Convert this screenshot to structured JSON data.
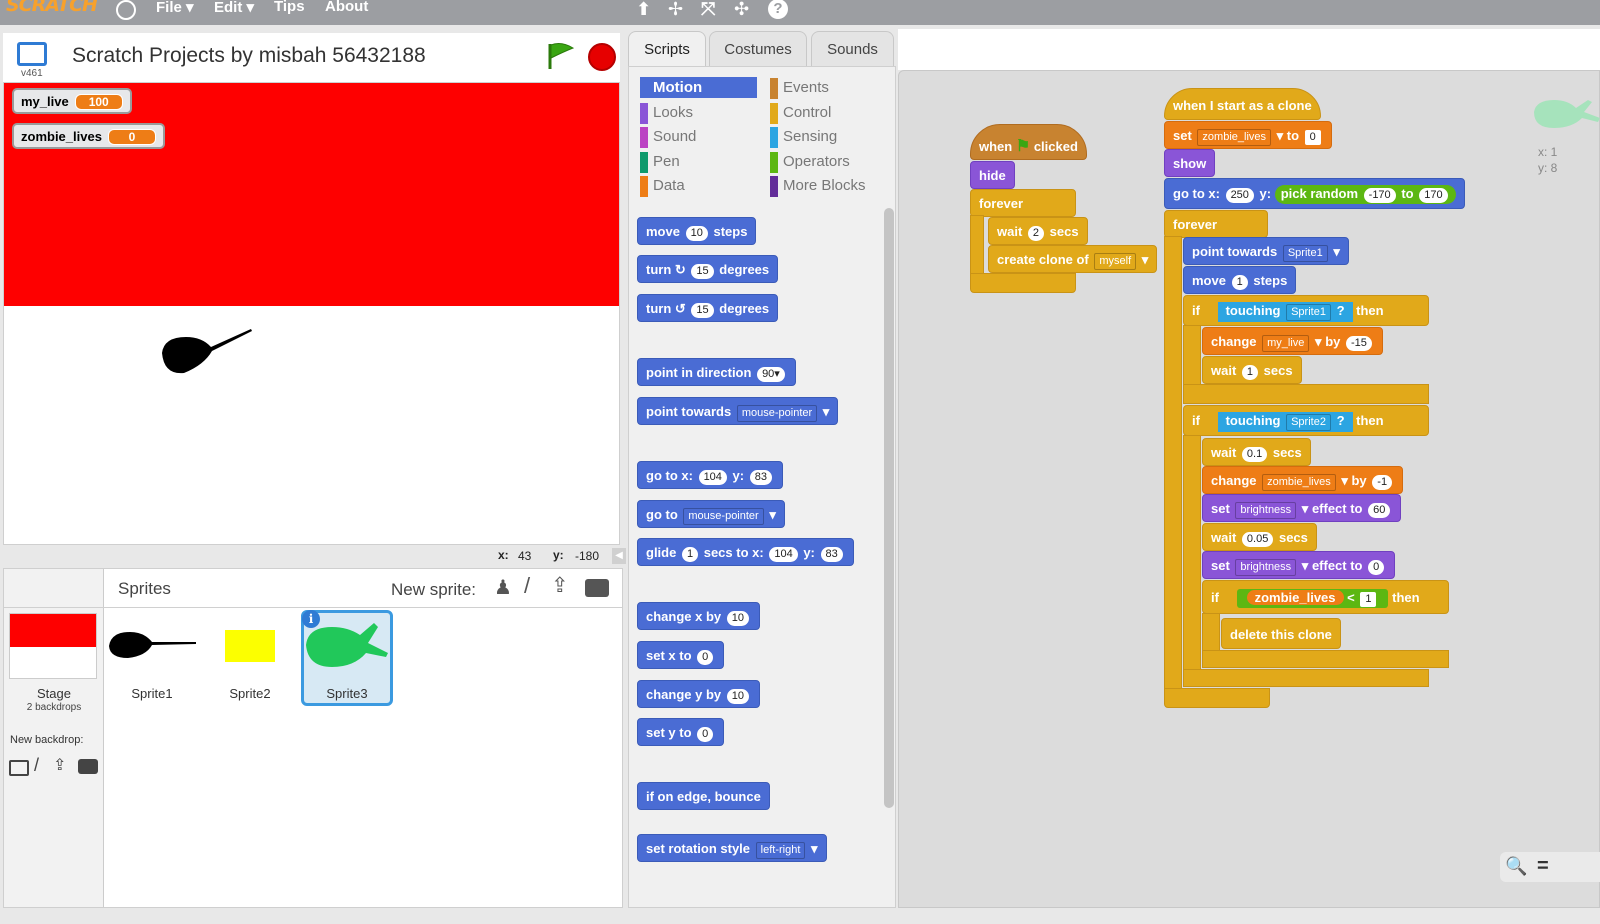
{
  "menubar": {
    "logo": "SCRATCH",
    "items": [
      "File ▾",
      "Edit ▾",
      "Tips",
      "About"
    ],
    "tool_icons": [
      "⬆",
      "✢",
      "⤧",
      "✣",
      "?"
    ]
  },
  "stage": {
    "title": "Scratch Projects by misbah 56432188",
    "version": "v461",
    "monitors": [
      {
        "label": "my_live",
        "value": "100"
      },
      {
        "label": "zombie_lives",
        "value": "0"
      }
    ],
    "coords_x_label": "x:",
    "coords_x": "43",
    "coords_y_label": "y:",
    "coords_y": "-180"
  },
  "sprites_pane": {
    "heading": "Sprites",
    "new_sprite_label": "New sprite:",
    "stage_label": "Stage",
    "stage_backdrops": "2 backdrops",
    "new_backdrop_label": "New backdrop:",
    "sprites": [
      {
        "name": "Sprite1"
      },
      {
        "name": "Sprite2"
      },
      {
        "name": "Sprite3"
      }
    ]
  },
  "tabs": [
    "Scripts",
    "Costumes",
    "Sounds"
  ],
  "categories": {
    "left": [
      "Motion",
      "Looks",
      "Sound",
      "Pen",
      "Data"
    ],
    "right": [
      "Events",
      "Control",
      "Sensing",
      "Operators",
      "More Blocks"
    ]
  },
  "palette": {
    "move": [
      "move",
      "10",
      "steps"
    ],
    "turn_right": [
      "turn",
      "15",
      "degrees"
    ],
    "turn_left": [
      "turn",
      "15",
      "degrees"
    ],
    "point_dir": [
      "point in direction",
      "90▾"
    ],
    "point_towards": [
      "point towards",
      "mouse-pointer"
    ],
    "goto_xy": [
      "go to x:",
      "104",
      "y:",
      "83"
    ],
    "goto": [
      "go to",
      "mouse-pointer"
    ],
    "glide": [
      "glide",
      "1",
      "secs to x:",
      "104",
      "y:",
      "83"
    ],
    "change_x": [
      "change x by",
      "10"
    ],
    "set_x": [
      "set x to",
      "0"
    ],
    "change_y": [
      "change y by",
      "10"
    ],
    "set_y": [
      "set y to",
      "0"
    ],
    "bounce": "if on edge, bounce",
    "rotation": [
      "set rotation style",
      "left-right"
    ]
  },
  "script1": {
    "hat": [
      "when",
      "clicked"
    ],
    "hide": "hide",
    "forever": "forever",
    "wait": [
      "wait",
      "2",
      "secs"
    ],
    "clone": [
      "create clone of",
      "myself"
    ]
  },
  "script2": {
    "hat": "when I start as a clone",
    "set": [
      "set",
      "zombie_lives",
      "to",
      "0"
    ],
    "show": "show",
    "goto": [
      "go to x:",
      "250",
      "y:",
      "pick random",
      "-170",
      "to",
      "170"
    ],
    "forever": "forever",
    "point": [
      "point towards",
      "Sprite1"
    ],
    "move": [
      "move",
      "1",
      "steps"
    ],
    "if1": [
      "if",
      "touching",
      "Sprite1",
      "?",
      "then"
    ],
    "change1": [
      "change",
      "my_live",
      "by",
      "-15"
    ],
    "wait1": [
      "wait",
      "1",
      "secs"
    ],
    "if2": [
      "if",
      "touching",
      "Sprite2",
      "?",
      "then"
    ],
    "wait2": [
      "wait",
      "0.1",
      "secs"
    ],
    "change2": [
      "change",
      "zombie_lives",
      "by",
      "-1"
    ],
    "set_eff1": [
      "set",
      "brightness",
      "effect to",
      "60"
    ],
    "wait3": [
      "wait",
      "0.05",
      "secs"
    ],
    "set_eff2": [
      "set",
      "brightness",
      "effect to",
      "0"
    ],
    "if3": [
      "if",
      "zombie_lives",
      "<",
      "1",
      "then"
    ],
    "delete": "delete this clone"
  },
  "sprite_info": {
    "x_label": "x: 1",
    "y_label": "y: 8"
  },
  "zoom": {
    "out": "🔍",
    "reset": "="
  },
  "colors": {
    "motion": "#4a6cd4",
    "looks": "#8a55d7",
    "sound": "#bb42c3",
    "pen": "#0e9a6c",
    "data": "#ee7d16",
    "events": "#c88330",
    "control": "#e1a91a",
    "sensing": "#2ca5e2",
    "operators": "#5cb712",
    "more": "#632d99",
    "stage_red": "#fe0000",
    "sprite_green": "#21c85a"
  }
}
